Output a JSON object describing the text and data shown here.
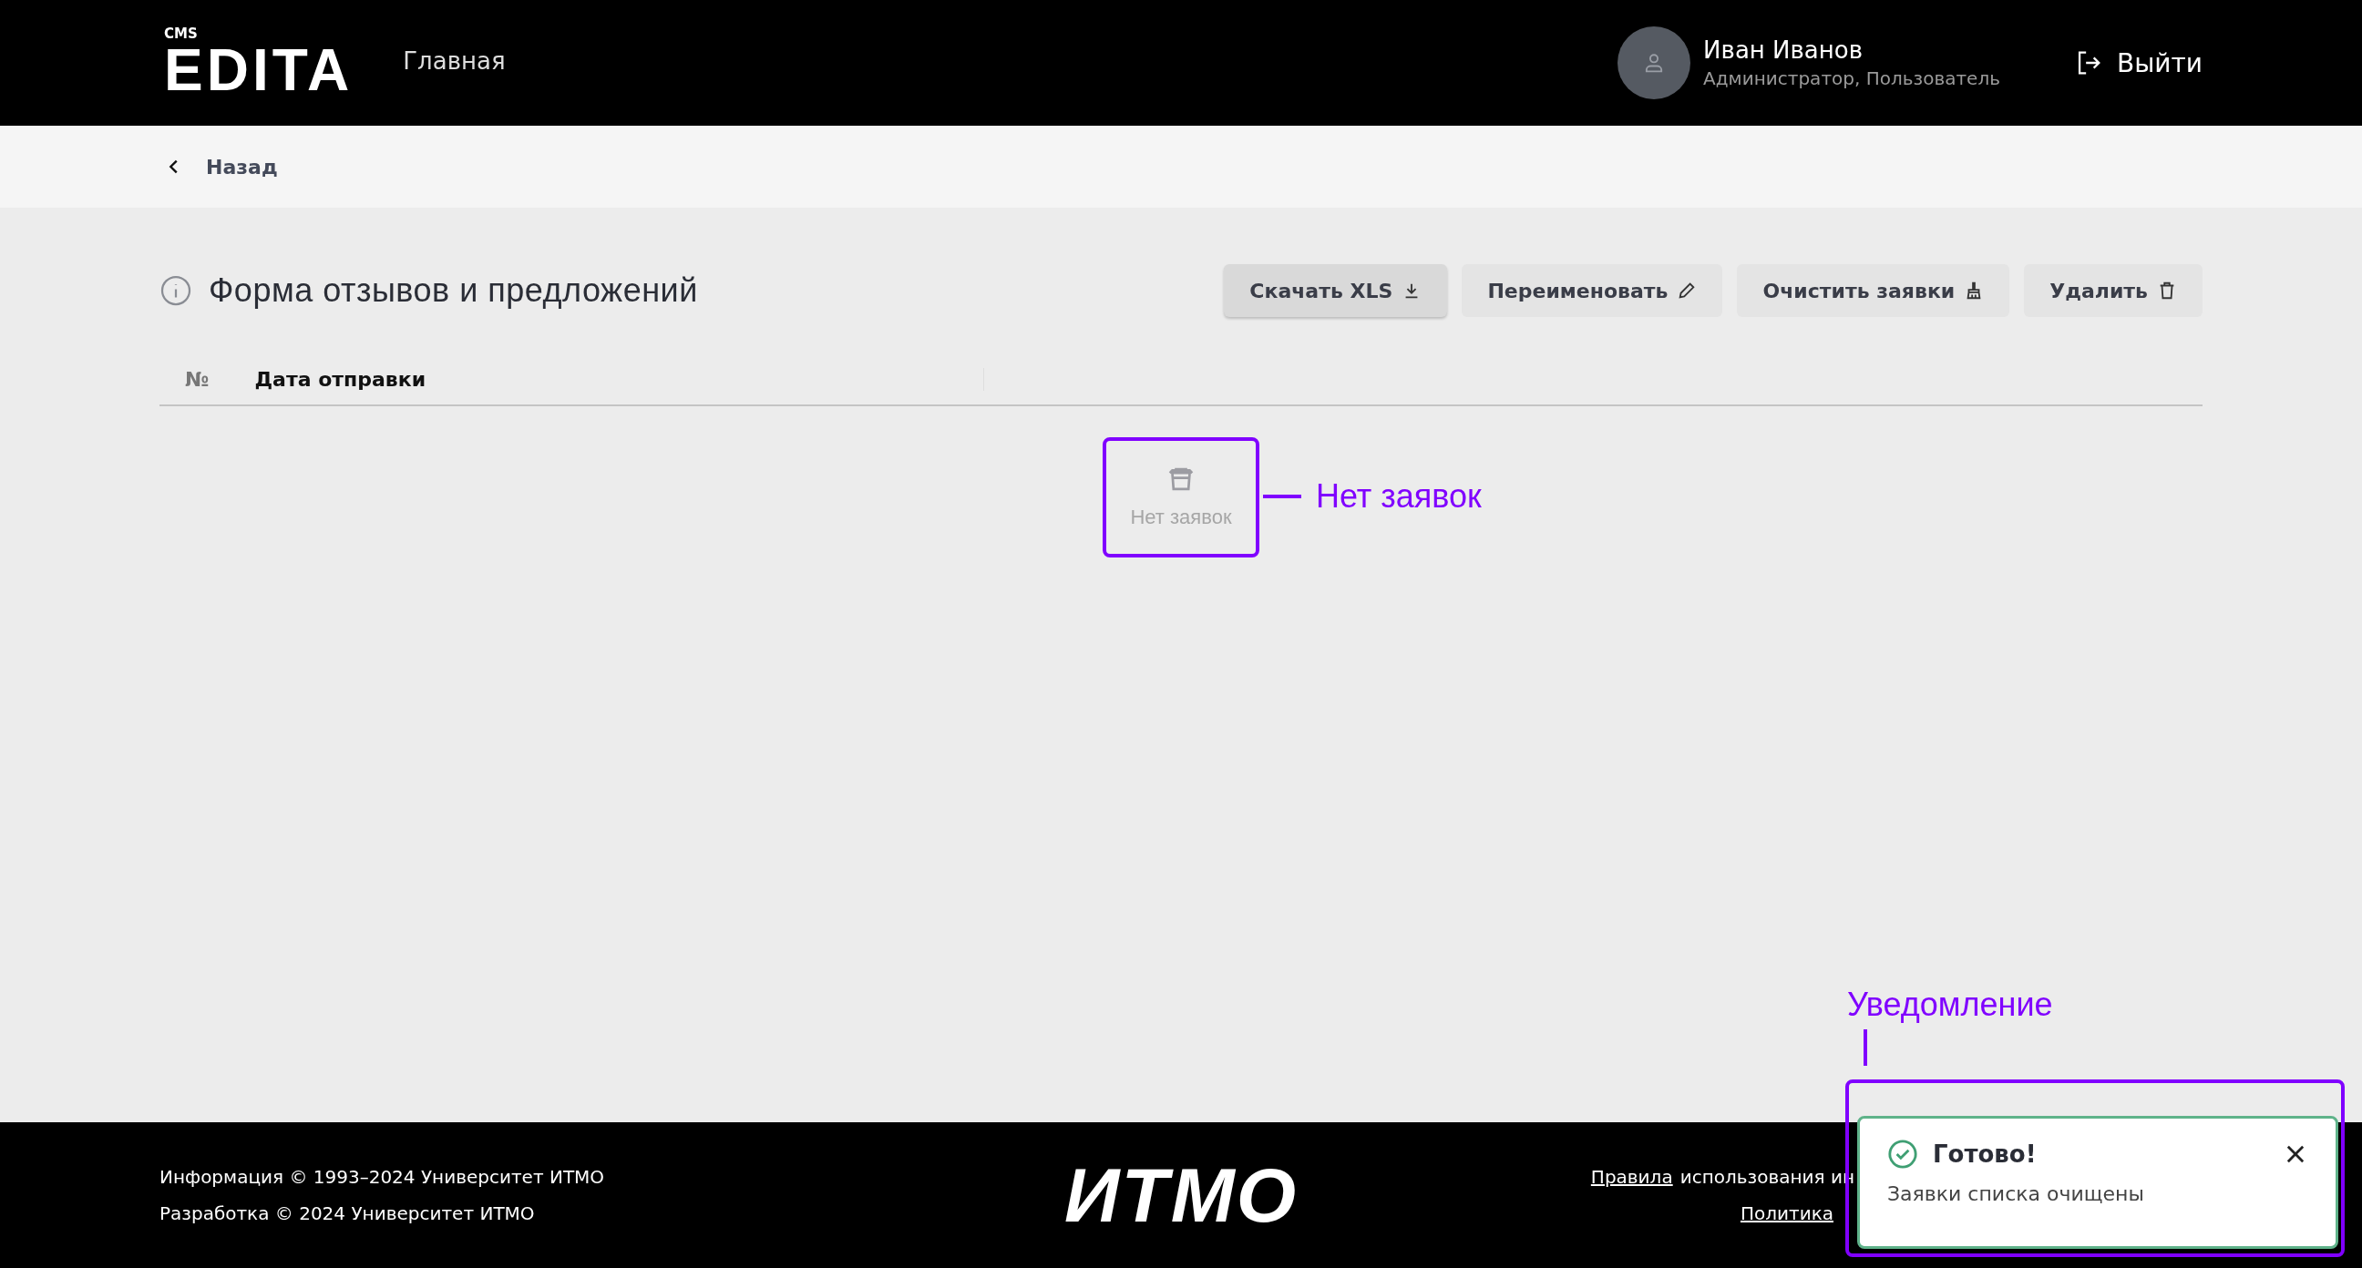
{
  "header": {
    "logo_small": "CMS",
    "logo": "EDITA",
    "nav": "Главная",
    "user": {
      "name": "Иван Иванов",
      "roles": "Администратор, Пользователь"
    },
    "logout": "Выйти"
  },
  "back": "Назад",
  "page": {
    "title": "Форма отзывов и предложений",
    "buttons": [
      {
        "label": "Скачать XLS",
        "kind": "download",
        "primary": true
      },
      {
        "label": "Переименовать",
        "kind": "edit",
        "primary": false
      },
      {
        "label": "Очистить заявки",
        "kind": "broom",
        "primary": false
      },
      {
        "label": "Удалить",
        "kind": "trash",
        "primary": false
      }
    ]
  },
  "table": {
    "columns": [
      "№",
      "Дата отправки"
    ],
    "empty": "Нет заявок"
  },
  "footer": {
    "left": [
      "Информация © 1993–2024 Университет ИТМО",
      "Разработка © 2024 Университет ИТМО"
    ],
    "logo": "ИТМО",
    "rules_link": "Правила",
    "rules_text": "использования ин",
    "policy_link": "Политика"
  },
  "toast": {
    "title": "Готово!",
    "message": "Заявки списка очищены"
  },
  "annotations": {
    "empty": "Нет заявок",
    "toast": "Уведомление"
  }
}
